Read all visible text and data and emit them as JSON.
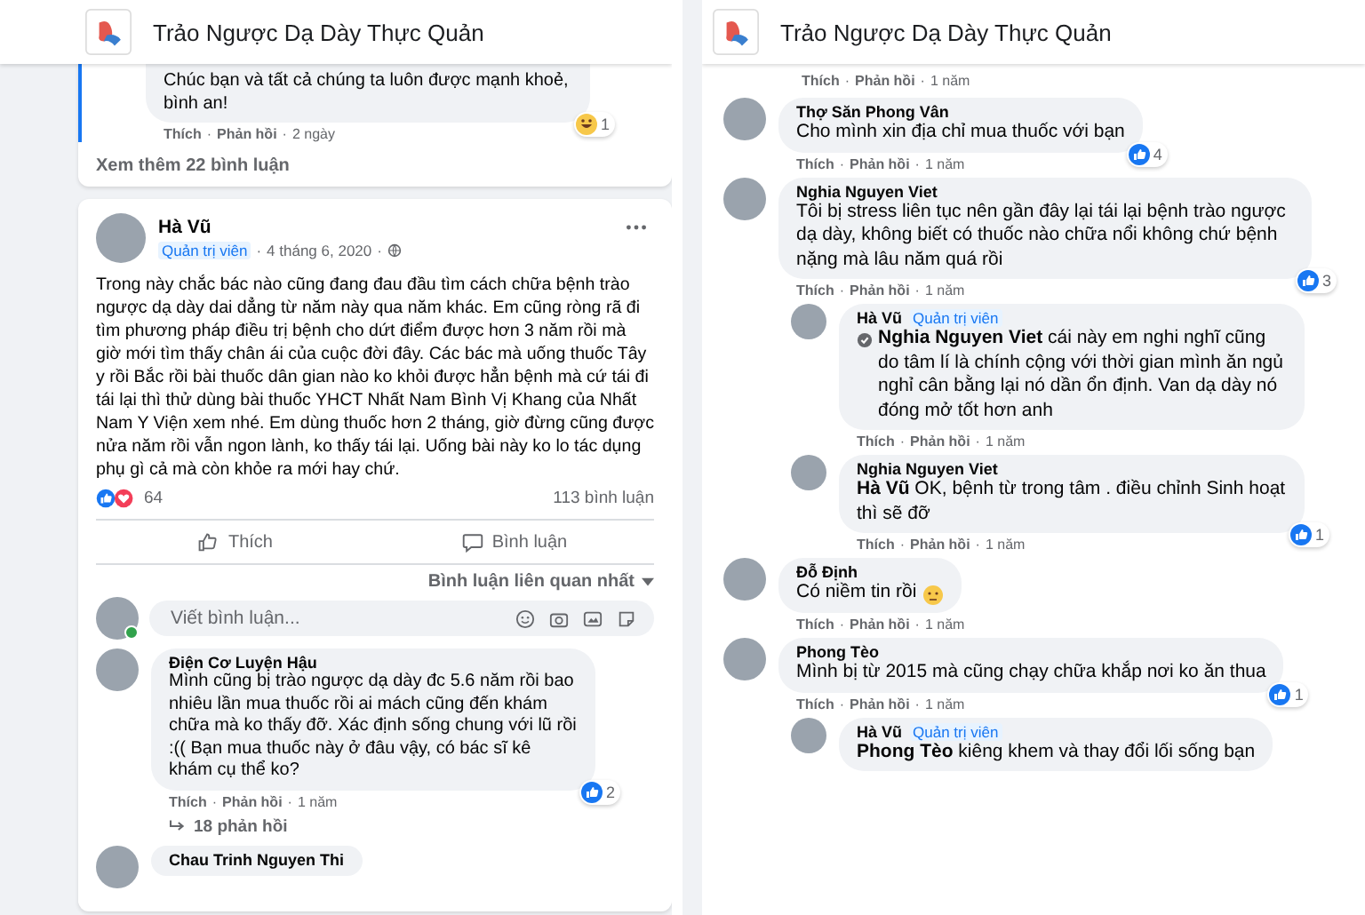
{
  "separator": "·",
  "left": {
    "page_title": "Trảo Ngược Dạ Dày Thực Quản",
    "top_comment": {
      "text": "Chúc bạn và tất cả chúng ta luôn được mạnh khoẻ, bình an!",
      "reaction": {
        "kind": "haha",
        "count": "1"
      },
      "meta": {
        "actions": [
          "Thích",
          "Phản hồi"
        ],
        "time": "2 ngày"
      }
    },
    "see_more": "Xem thêm 22 bình luận",
    "post": {
      "author": "Hà Vũ",
      "badge": "Quản trị viên",
      "date": "4 tháng 6, 2020",
      "text": "Trong này chắc bác nào cũng đang đau đầu tìm cách chữa bệnh trào ngược dạ dày dai dẳng từ năm này qua năm khác. Em cũng ròng rã đi tìm phương pháp điều trị bệnh cho dứt điểm được hơn 3 năm rồi mà giờ mới tìm thấy chân ái của cuộc đời đây. Các bác mà uống thuốc Tây y rồi Bắc rồi bài thuốc dân gian nào ko khỏi được hẳn bệnh mà cứ tái đi tái lại thì thử dùng bài thuốc YHCT Nhất Nam Bình Vị Khang của Nhất Nam Y Viện xem nhé. Em dùng thuốc hơn 2 tháng, giờ đừng cũng được nửa năm rồi vẫn ngon lành, ko thấy tái lại. Uống bài này ko lo tác dụng phụ gì cả mà còn khỏe ra mới hay chứ.",
      "reaction_count": "64",
      "comments_count": "113 bình luận",
      "actions": [
        {
          "kind": "like",
          "label": "Thích"
        },
        {
          "kind": "comment",
          "label": "Bình luận"
        }
      ],
      "sort": "Bình luận liên quan nhất",
      "composer": {
        "placeholder": "Viết bình luận...",
        "online": true
      },
      "comments": [
        {
          "name": "Điện Cơ Luyện Hậu",
          "text": "Mình cũng bị trào ngược dạ dày đc 5.6 năm rồi bao nhiêu lần mua thuốc rồi ai mách cũng đến khám chữa mà ko thấy đỡ. Xác định sống chung với lũ rồi :(( Bạn mua thuốc này ở đâu vậy, có bác sĩ kê khám cụ thể ko?",
          "reaction": {
            "kind": "like",
            "count": "2"
          },
          "meta": {
            "actions": [
              "Thích",
              "Phản hồi"
            ],
            "time": "1 năm"
          },
          "replies_link": "18 phản hồi"
        },
        {
          "name": "Chau Trinh Nguyen Thi"
        }
      ]
    }
  },
  "right": {
    "page_title": "Trảo Ngược Dạ Dày Thực Quản",
    "top_meta": {
      "actions": [
        "Thích",
        "Phản hồi"
      ],
      "time": "1 năm"
    },
    "comments": [
      {
        "name": "Thợ Săn Phong Vân",
        "text": "Cho mình xin địa chỉ mua thuốc với bạn",
        "reaction": {
          "kind": "like",
          "count": "4"
        },
        "meta": {
          "actions": [
            "Thích",
            "Phản hồi"
          ],
          "time": "1 năm"
        }
      },
      {
        "name": "Nghia Nguyen Viet",
        "text": "Tôi bị stress liên tục nên gần đây lại tái lại bệnh trào ngược dạ dày, không biết có thuốc nào chữa nổi không chứ bệnh nặng mà lâu năm quá rồi",
        "reaction": {
          "kind": "like",
          "count": "3"
        },
        "meta": {
          "actions": [
            "Thích",
            "Phản hồi"
          ],
          "time": "1 năm"
        },
        "children": [
          {
            "name": "Hà Vũ",
            "badge": "Quản trị viên",
            "text": "**Nghia Nguyen Viet** cái này em nghi nghĩ cũng do tâm lí là chính cộng với thời gian mình ăn ngủ nghỉ cân bằng lại nó dần ổn định. Van dạ dày nó đóng mở tốt hơn anh",
            "mention_icon": true,
            "meta": {
              "actions": [
                "Thích",
                "Phản hồi"
              ],
              "time": "1 năm"
            }
          },
          {
            "name": "Nghia Nguyen Viet",
            "text": "**Hà Vũ** OK, bệnh từ trong tâm . điều chỉnh Sinh hoạt thì sẽ đỡ",
            "reaction": {
              "kind": "like",
              "count": "1"
            },
            "meta": {
              "actions": [
                "Thích",
                "Phản hồi"
              ],
              "time": "1 năm"
            }
          }
        ]
      },
      {
        "name": "Đỗ Định",
        "text": "Có niềm tin rồi",
        "emoji": true,
        "meta": {
          "actions": [
            "Thích",
            "Phản hồi"
          ],
          "time": "1 năm"
        }
      },
      {
        "name": "Phong Tèo",
        "text": "Mình bị từ 2015 mà cũng chạy chữa khắp nơi ko ăn thua",
        "reaction": {
          "kind": "like",
          "count": "1"
        },
        "meta": {
          "actions": [
            "Thích",
            "Phản hồi"
          ],
          "time": "1 năm"
        },
        "children": [
          {
            "name": "Hà Vũ",
            "badge": "Quản trị viên",
            "text": "**Phong Tèo** kiêng khem và thay đổi lối sống bạn"
          }
        ]
      }
    ]
  }
}
